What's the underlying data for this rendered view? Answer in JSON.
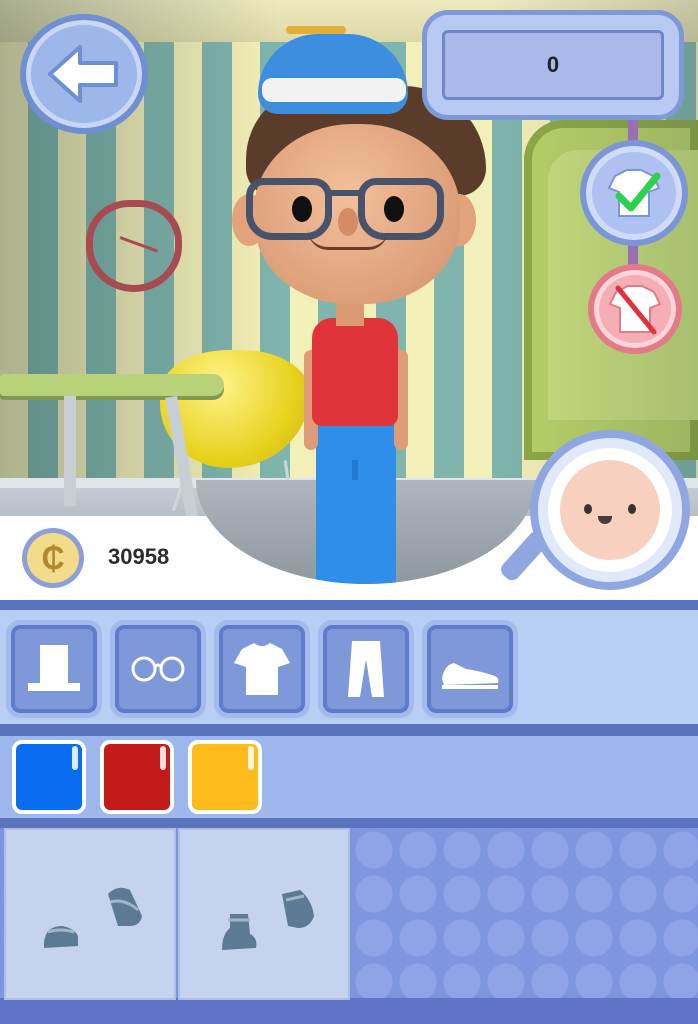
{
  "hud": {
    "score_value": "0",
    "coin_symbol": "₵",
    "coin_amount": "30958"
  },
  "icons": {
    "back": "left-arrow-icon",
    "confirm": "shirt-checkmark-icon",
    "remove": "shirt-crossed-out-icon",
    "zoom": "magnifier-face-icon"
  },
  "categories": [
    {
      "name": "hat",
      "icon": "top-hat-icon"
    },
    {
      "name": "glasses",
      "icon": "glasses-icon"
    },
    {
      "name": "shirt",
      "icon": "t-shirt-icon"
    },
    {
      "name": "pants",
      "icon": "pants-icon"
    },
    {
      "name": "shoes",
      "icon": "sneaker-icon"
    }
  ],
  "colors": [
    "#0a6cf0",
    "#c31a1a",
    "#fdbb1c"
  ],
  "items": [
    {
      "name": "shoe-style-1",
      "icon": "strap-shoes-icon"
    },
    {
      "name": "shoe-style-2",
      "icon": "boots-icon"
    }
  ],
  "theme": {
    "panel_blue": "#7e98da",
    "accent_border": "#5a73bd",
    "confirm_green": "#2fd04c",
    "remove_red": "#e0323e"
  }
}
